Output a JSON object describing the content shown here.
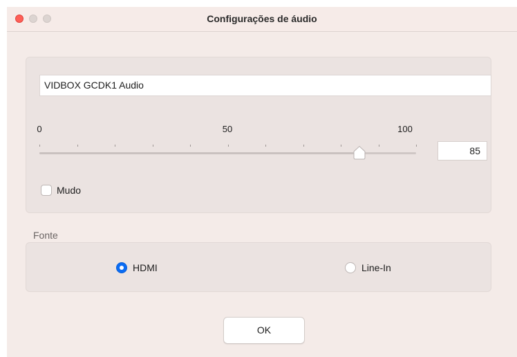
{
  "window": {
    "title": "Configurações de áudio"
  },
  "device": {
    "name": "VIDBOX GCDK1 Audio"
  },
  "volume": {
    "scale_labels": [
      "0",
      "50",
      "100"
    ],
    "min": 0,
    "max": 100,
    "value": 85,
    "value_text": "85"
  },
  "mute": {
    "label": "Mudo",
    "checked": false
  },
  "source": {
    "label": "Fonte",
    "options": [
      {
        "label": "HDMI",
        "selected": true
      },
      {
        "label": "Line-In",
        "selected": false
      }
    ]
  },
  "buttons": {
    "ok_label": "OK"
  },
  "colors": {
    "accent": "#0a6cf3",
    "close": "#fe5f57",
    "window_bg": "#f4ebe8",
    "panel_bg": "#ebe3e1"
  }
}
